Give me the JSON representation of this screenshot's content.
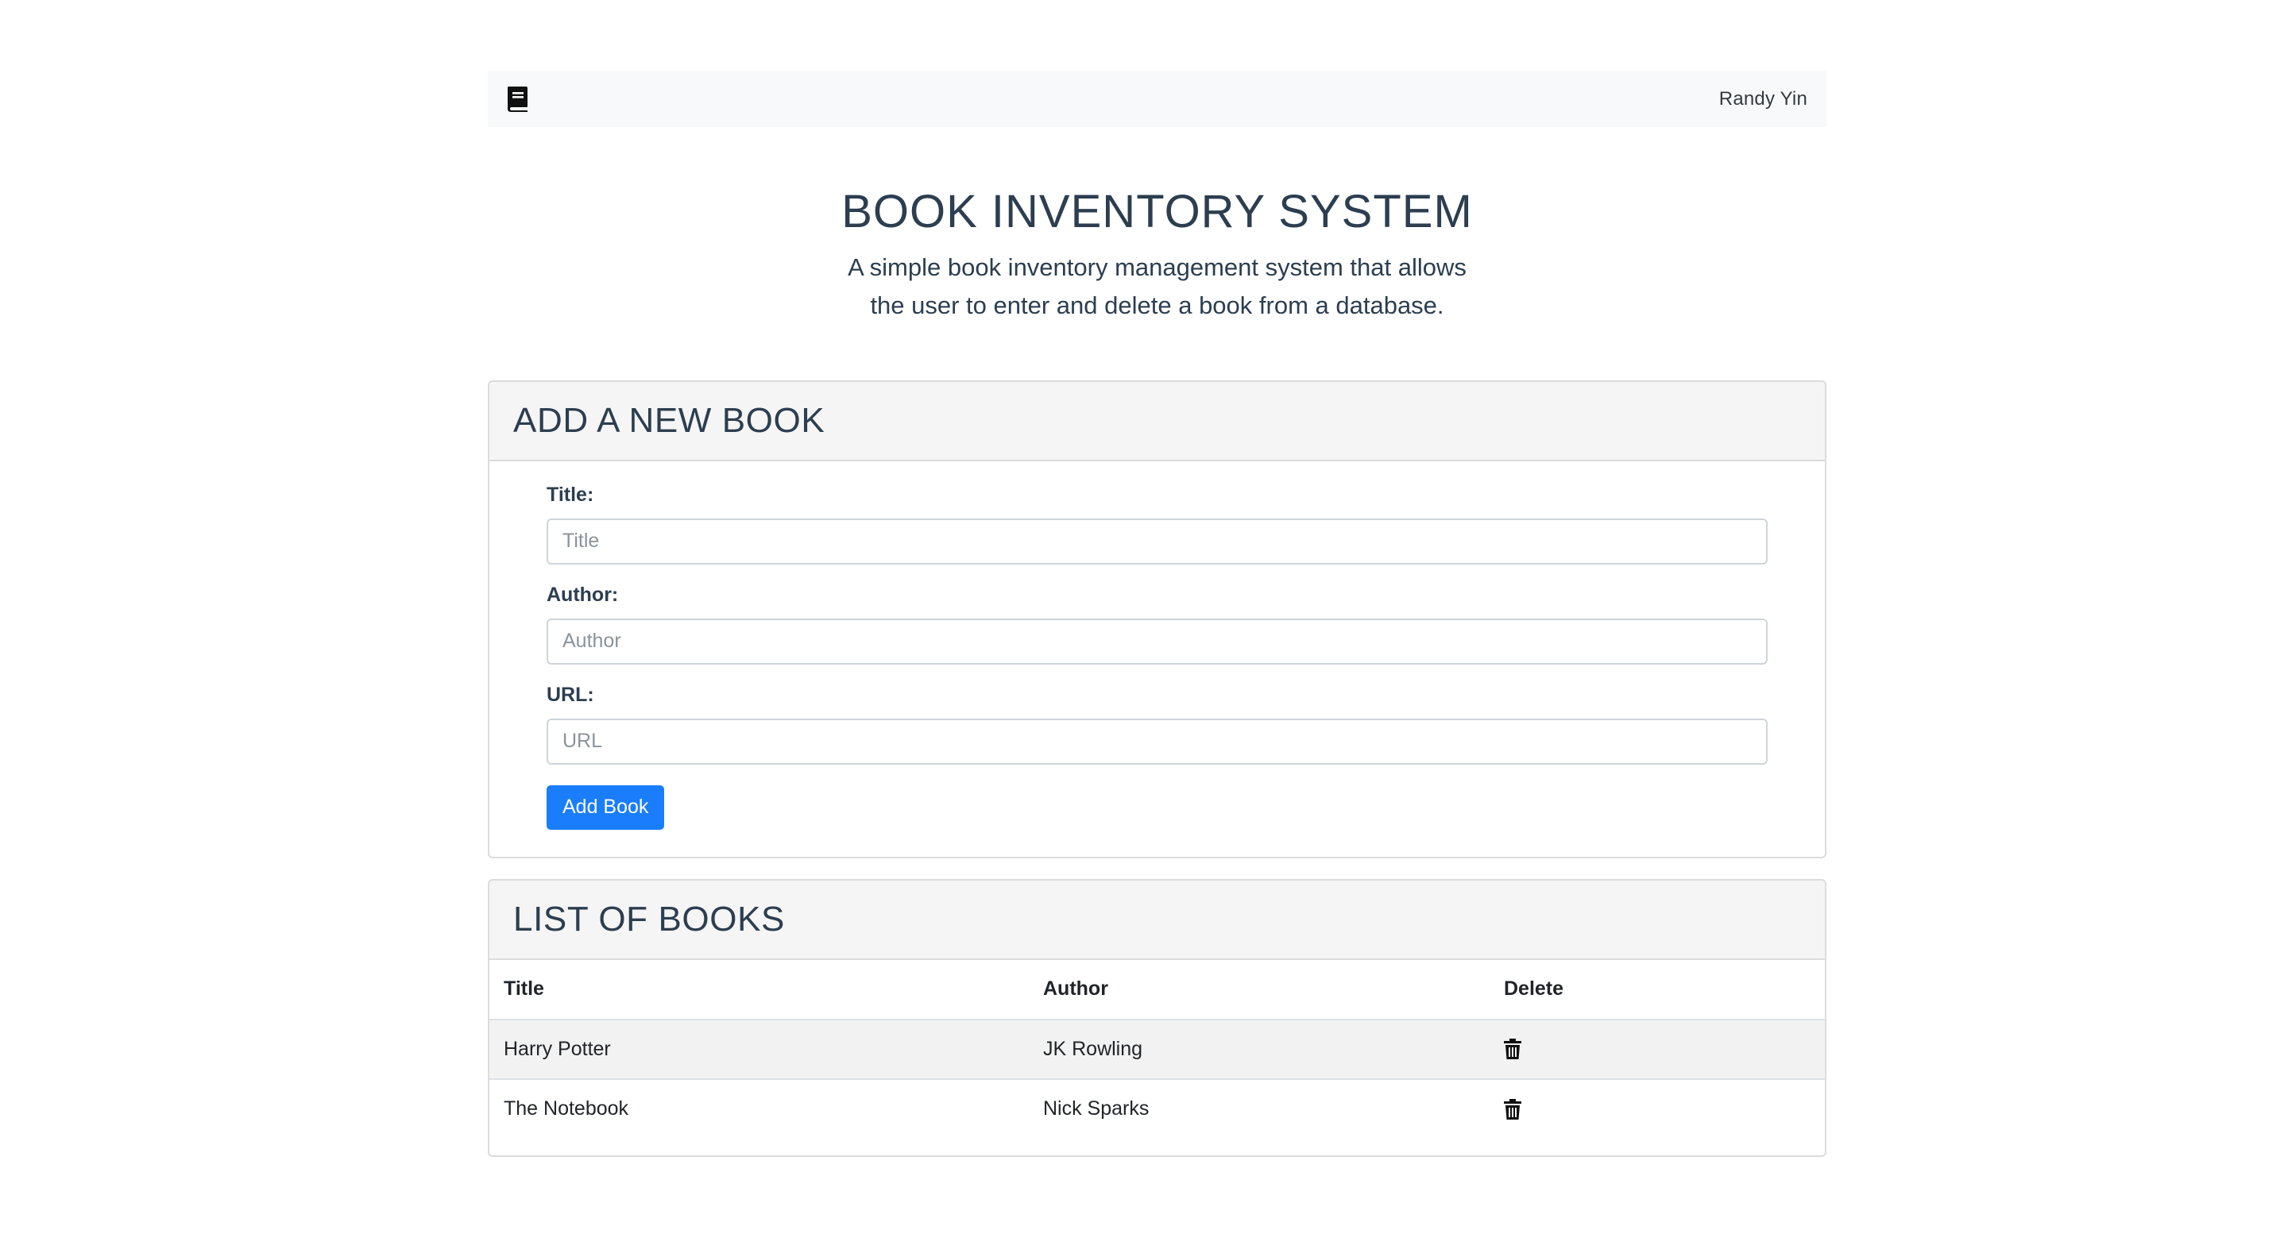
{
  "navbar": {
    "user_name": "Randy Yin",
    "icon": "book-icon"
  },
  "hero": {
    "title": "BOOK INVENTORY SYSTEM",
    "subtitle": "A simple book inventory management system that allows the user to enter and delete a book from a database."
  },
  "add_form": {
    "heading": "ADD A NEW BOOK",
    "fields": [
      {
        "label": "Title:",
        "placeholder": "Title",
        "value": ""
      },
      {
        "label": "Author:",
        "placeholder": "Author",
        "value": ""
      },
      {
        "label": "URL:",
        "placeholder": "URL",
        "value": ""
      }
    ],
    "submit_label": "Add Book"
  },
  "book_list": {
    "heading": "LIST OF BOOKS",
    "columns": [
      "Title",
      "Author",
      "Delete"
    ],
    "rows": [
      {
        "title": "Harry Potter",
        "author": "JK Rowling",
        "delete_icon": "trash-icon"
      },
      {
        "title": "The Notebook",
        "author": "Nick Sparks",
        "delete_icon": "trash-icon"
      }
    ]
  },
  "colors": {
    "primary": "#1a7dfb",
    "heading_text": "#2c3e50",
    "navbar_bg": "#f8f9fa",
    "card_header_bg": "#f5f5f5",
    "striped_row_bg": "#f2f2f2"
  }
}
